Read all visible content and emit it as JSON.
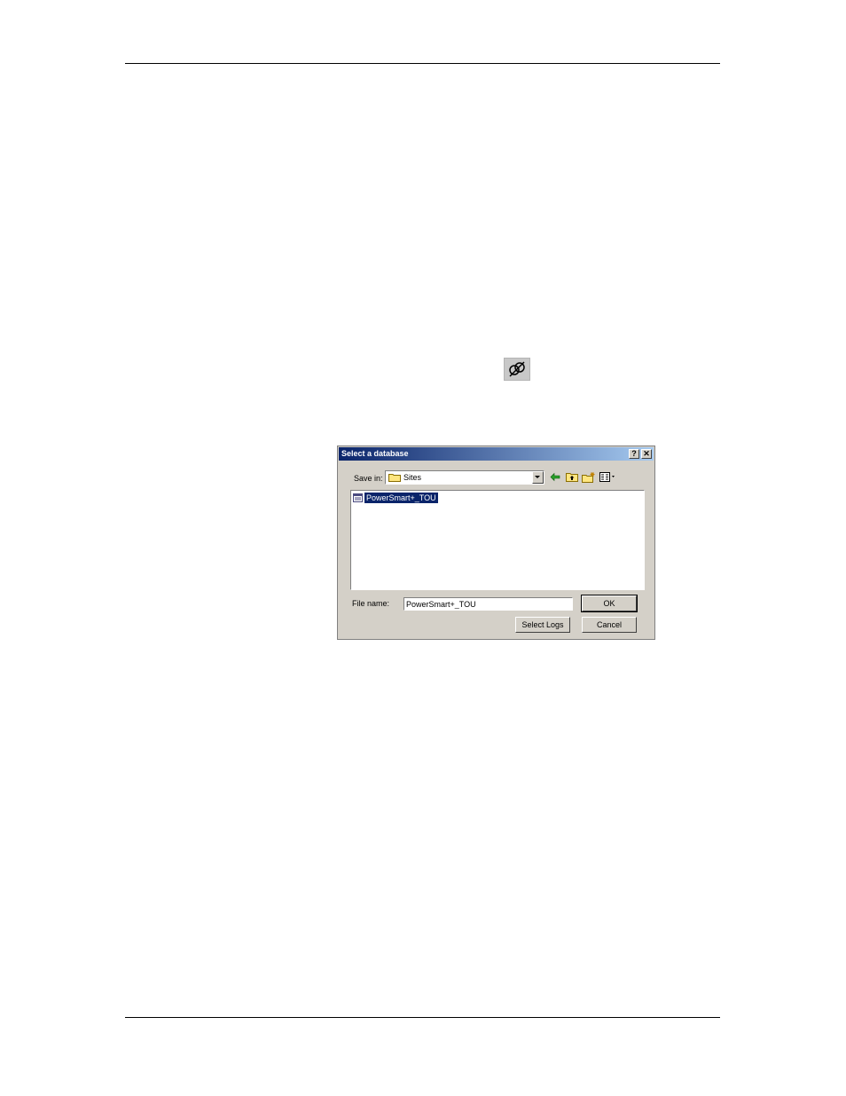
{
  "dialog": {
    "title": "Select a database",
    "help_label": "?",
    "close_label": "✕",
    "save_in_label": "Save in:",
    "save_in_value": "Sites",
    "files": [
      {
        "name": "PowerSmart+_TOU",
        "selected": true
      }
    ],
    "file_name_label": "File name:",
    "file_name_value": "PowerSmart+_TOU",
    "ok_label": "OK",
    "cancel_label": "Cancel",
    "select_logs_label": "Select Logs"
  },
  "colors": {
    "dialog_face": "#d4d0c8",
    "title_gradient_start": "#0a246a",
    "title_gradient_end": "#a6caf0",
    "selection": "#0a246a"
  },
  "icons": {
    "toolbar": "connect-icon",
    "folder": "folder-icon",
    "back": "back-arrow-icon",
    "up": "up-folder-icon",
    "new_folder": "new-folder-icon",
    "view": "view-menu-icon",
    "file": "database-file-icon"
  }
}
